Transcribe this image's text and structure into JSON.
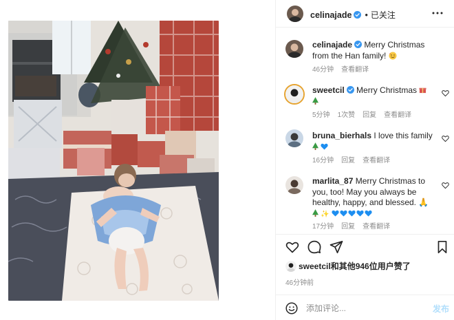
{
  "post": {
    "username": "celinajade",
    "follow_state": "已关注",
    "likes_text": "sweetcil和其他946位用户赞了",
    "timestamp": "46分钟前"
  },
  "caption": {
    "username": "celinajade",
    "text": "Merry Christmas from the Han family!",
    "time": "46分钟",
    "see_translation": "查看翻译"
  },
  "comments": [
    {
      "username": "sweetcil",
      "text": "Merry Christmas",
      "time": "5分钟",
      "likes": "1次赞",
      "reply": "回复",
      "see_translation": "查看翻译"
    },
    {
      "username": "bruna_bierhals",
      "text": "I love this family",
      "time": "16分钟",
      "reply": "回复",
      "see_translation": "查看翻译"
    },
    {
      "username": "marlita_87",
      "text": "Merry Christmas to you, too! May you always be healthy, happy, and blessed.",
      "time": "17分钟",
      "reply": "回复",
      "see_translation": "查看翻译"
    }
  ],
  "composer": {
    "placeholder": "添加评论...",
    "post_label": "发布"
  },
  "icons": {
    "more": "more-horizontal-icon",
    "like": "heart-outline-icon",
    "comment": "comment-bubble-icon",
    "share": "paper-plane-icon",
    "save": "bookmark-icon",
    "emoji": "smiley-icon",
    "verified": "verified-badge-icon"
  },
  "colors": {
    "verified_blue": "#3897f0",
    "muted_text": "#8e8e8e",
    "post_button_disabled": "#b2dffc",
    "divider": "#efefef"
  }
}
